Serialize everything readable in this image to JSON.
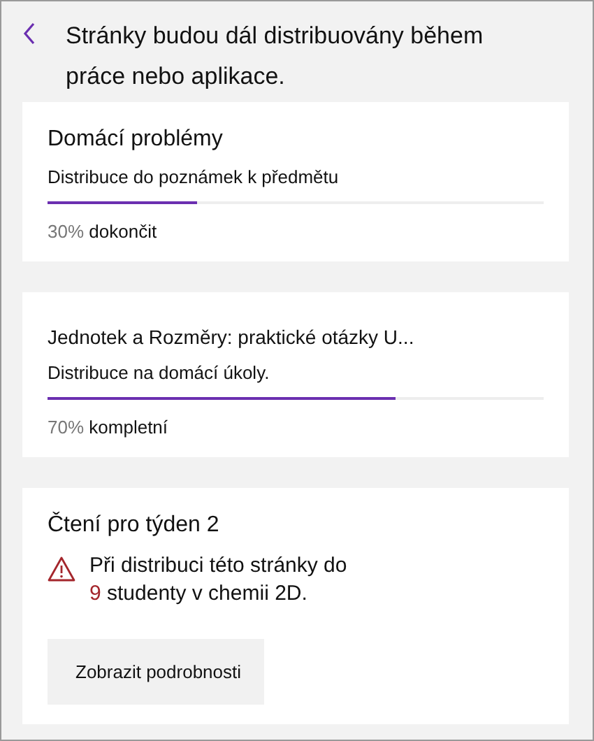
{
  "header": {
    "title": "Stránky budou dál distribuovány během práce nebo aplikace."
  },
  "cards": [
    {
      "kind": "progress",
      "title": "Domácí problémy",
      "subtitle": "Distribuce do poznámek k předmětu",
      "level": 0.3,
      "percent": "30%",
      "status": "dokončit"
    },
    {
      "kind": "progress",
      "title": "Jednotek a  Rozměry: praktické otázky U...",
      "subtitle": "Distribuce na domácí úkoly.",
      "level": 0.7,
      "percent": "70%",
      "status": "kompletní"
    },
    {
      "kind": "warning",
      "title": "Čtení pro týden 2",
      "message_start": "Při distribuci této stránky do",
      "count": "9",
      "message_end": "studenty v chemii 2D.",
      "button": "Zobrazit podrobnosti"
    }
  ]
}
